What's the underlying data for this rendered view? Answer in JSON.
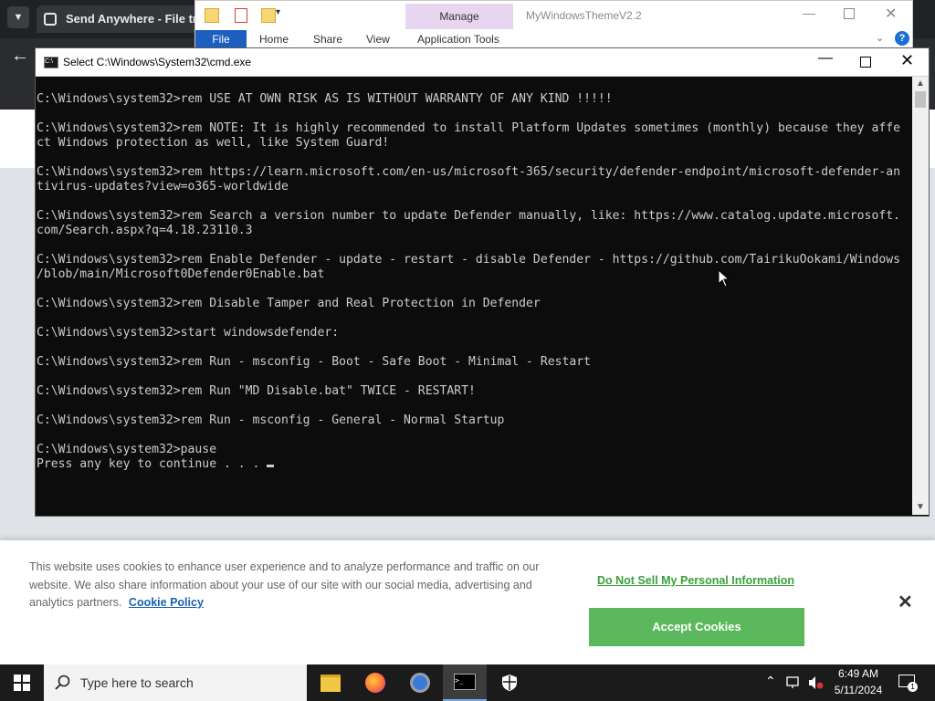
{
  "browser": {
    "tab_title": "Send Anywhere - File trans"
  },
  "explorer": {
    "title": "MyWindowsThemeV2.2",
    "manage_label": "Manage",
    "tabs": [
      "File",
      "Home",
      "Share",
      "View",
      "Application Tools"
    ]
  },
  "cmd": {
    "title": "Select C:\\Windows\\System32\\cmd.exe",
    "lines": [
      "C:\\Windows\\system32>rem USE AT OWN RISK AS IS WITHOUT WARRANTY OF ANY KIND !!!!!",
      "",
      "C:\\Windows\\system32>rem NOTE: It is highly recommended to install Platform Updates sometimes (monthly) because they affe",
      "ct Windows protection as well, like System Guard!",
      "",
      "C:\\Windows\\system32>rem https://learn.microsoft.com/en-us/microsoft-365/security/defender-endpoint/microsoft-defender-an",
      "tivirus-updates?view=o365-worldwide",
      "",
      "C:\\Windows\\system32>rem Search a version number to update Defender manually, like: https://www.catalog.update.microsoft.",
      "com/Search.aspx?q=4.18.23110.3",
      "",
      "C:\\Windows\\system32>rem Enable Defender - update - restart - disable Defender - https://github.com/TairikuOokami/Windows",
      "/blob/main/Microsoft0Defender0Enable.bat",
      "",
      "C:\\Windows\\system32>rem Disable Tamper and Real Protection in Defender",
      "",
      "C:\\Windows\\system32>start windowsdefender:",
      "",
      "C:\\Windows\\system32>rem Run - msconfig - Boot - Safe Boot - Minimal - Restart",
      "",
      "C:\\Windows\\system32>rem Run \"MD Disable.bat\" TWICE - RESTART!",
      "",
      "C:\\Windows\\system32>rem Run - msconfig - General - Normal Startup",
      "",
      "C:\\Windows\\system32>pause",
      "Press any key to continue . . . "
    ]
  },
  "cookie": {
    "text": "This website uses cookies to enhance user experience and to analyze performance and traffic on our website. We also share information about your use of our site with our social media, advertising and analytics partners.",
    "policy_link": "Cookie Policy",
    "do_not_sell": "Do Not Sell My Personal Information",
    "accept": "Accept Cookies",
    "accent": "#5cb85c"
  },
  "taskbar": {
    "search_placeholder": "Type here to search",
    "time": "6:49 AM",
    "date": "5/11/2024",
    "notification_count": "1"
  }
}
